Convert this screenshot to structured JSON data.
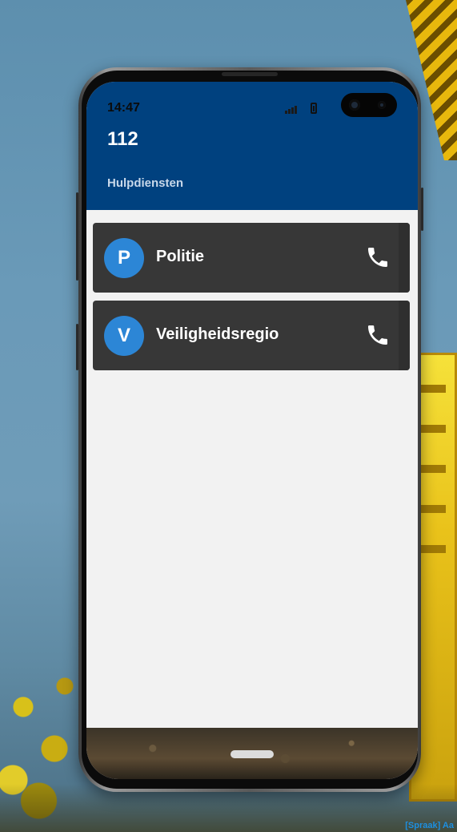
{
  "status_bar": {
    "time": "14:47"
  },
  "header": {
    "title": "112",
    "subtitle": "Hulpdiensten"
  },
  "contacts": [
    {
      "initial": "P",
      "name": "Politie",
      "icon": "phone-icon"
    },
    {
      "initial": "V",
      "name": "Veiligheidsregio",
      "icon": "phone-icon"
    }
  ],
  "colors": {
    "header_bg": "#00417f",
    "card_bg": "#373737",
    "avatar_bg": "#2c86d6",
    "screen_bg": "#f2f2f2",
    "label_blue": "#1d8fe0"
  },
  "footer": {
    "speech_label": "[Spraak] Aa"
  }
}
